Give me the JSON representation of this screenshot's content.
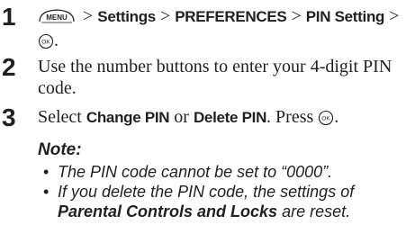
{
  "steps": [
    {
      "number": "1",
      "menu_key_label": "MENU",
      "sep1": " > ",
      "item1": "Settings",
      "sep2": " > ",
      "item2": "PREFERENCES",
      "sep3": " > ",
      "item3": "PIN Setting",
      "sep4": " >",
      "end": "."
    },
    {
      "number": "2",
      "text": "Use the number buttons to enter your 4-digit PIN code."
    },
    {
      "number": "3",
      "pre": "Select ",
      "opt1": "Change PIN",
      "mid": " or ",
      "opt2": "Delete PIN",
      "post": ". Press ",
      "end": "."
    }
  ],
  "note": {
    "heading": "Note:",
    "bullet": "•",
    "item1": "The PIN code cannot be set to “0000”.",
    "item2_pre": "If you delete the PIN code, the settings of ",
    "item2_bold": "Parental Controls and Locks",
    "item2_post": " are reset."
  },
  "icons": {
    "menu_button": "menu-button-icon",
    "ok_button": "ok-button-icon"
  }
}
